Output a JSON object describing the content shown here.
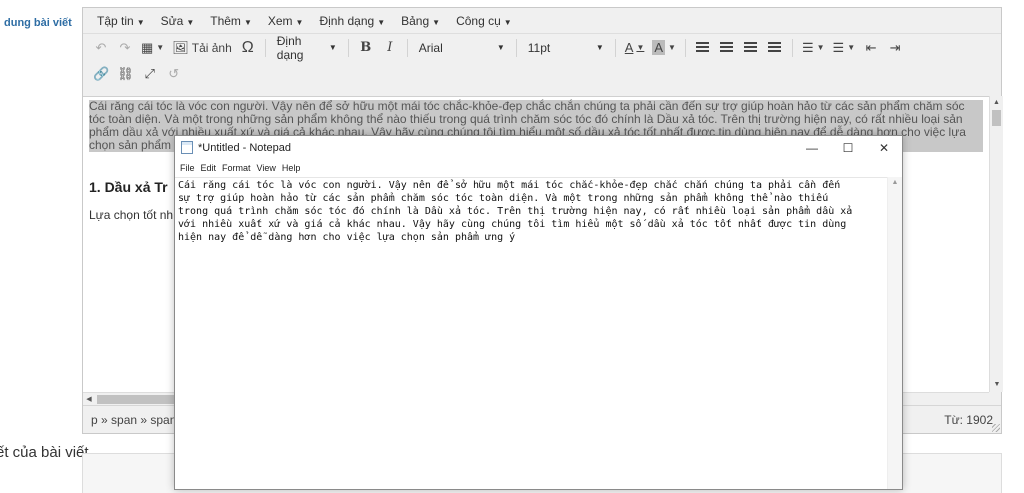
{
  "page": {
    "side_label": "dung bài viết",
    "bottom_label": "ết của bài viết"
  },
  "menubar": [
    "Tập tin",
    "Sửa",
    "Thêm",
    "Xem",
    "Định dạng",
    "Bảng",
    "Công cụ"
  ],
  "toolbar": {
    "image_label": "Tải ảnh",
    "format_select": "Định dạng",
    "font_family": "Arial",
    "font_size": "11pt"
  },
  "content": {
    "highlighted": "Cái răng cái tóc là vóc con người. Vậy nên để sở hữu một mái tóc chắc-khỏe-đẹp chắc chắn chúng ta phải cần đến sự trợ giúp hoàn hảo từ các sản phẩm chăm sóc tóc toàn diện. Và một trong những sản phẩm không thể nào thiếu trong quá trình chăm sóc tóc đó chính là Dầu xả tóc. Trên thị trường hiện nay, có rất nhiều loại sản phẩm dầu xả với nhiều xuất xứ và giá cả khác nhau. Vậy hãy cùng chúng tôi tìm hiểu một số dầu xả tóc tốt nhất được tin dùng hiện nay để dễ dàng hơn cho việc lựa chọn sản phẩm ưng ý chăm sóc mái tó",
    "heading": "1. Dầu xả Tr",
    "lead": "Lựa chọn tốt nh"
  },
  "statusbar": {
    "path": "p » span » span",
    "word_count": "Từ: 1902"
  },
  "notepad": {
    "title": "*Untitled - Notepad",
    "menu": [
      "File",
      "Edit",
      "Format",
      "View",
      "Help"
    ],
    "text": "Cái răng cái tóc là vóc con người. Vậy nên để sở hữu một mái tóc chắc-khỏe-đẹp chắc chắn chúng ta phải cần đến\nsự trợ giúp hoàn hảo từ các sản phẩm chăm sóc tóc toàn diện. Và một trong những sản phẩm không thể nào thiếu\ntrong quá trình chăm sóc tóc đó chính là Dầu xả tóc. Trên thị trường hiện nay, có rất nhiều loại sản phẩm dầu xả\nvới nhiều xuất xứ và giá cả khác nhau. Vậy hãy cùng chúng tôi tìm hiểu một số dầu xả tóc tốt nhất được tin dùng\nhiện nay để dễ dàng hơn cho việc lựa chọn sản phẩm ưng ý",
    "minimize": "—",
    "maximize": "☐",
    "close": "✕"
  },
  "colors": {
    "selection": "#c8c8c8",
    "label_blue": "#2e6da4",
    "toolbar_bg": "#f0f0f0"
  }
}
